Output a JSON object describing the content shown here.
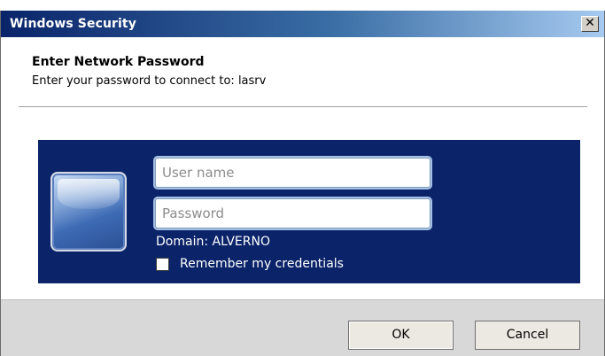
{
  "window": {
    "title": "Windows Security",
    "close_glyph": "✕",
    "close_icon": "close-icon"
  },
  "dialog": {
    "heading": "Enter Network Password",
    "subheading": "Enter your password to connect to: lasrv"
  },
  "credentials": {
    "username_placeholder": "User name",
    "username_value": "",
    "password_placeholder": "Password",
    "password_value": "",
    "domain_text": "Domain: ALVERNO",
    "remember_label": "Remember my credentials",
    "remember_checked": false,
    "tile_icon": "user-tile-icon"
  },
  "buttons": {
    "ok_label": "OK",
    "cancel_label": "Cancel"
  },
  "colors": {
    "panel_background": "#0b2469",
    "titlebar_start": "#0a246a",
    "titlebar_end": "#a6caf0",
    "footer_background": "#d8d8d8"
  }
}
